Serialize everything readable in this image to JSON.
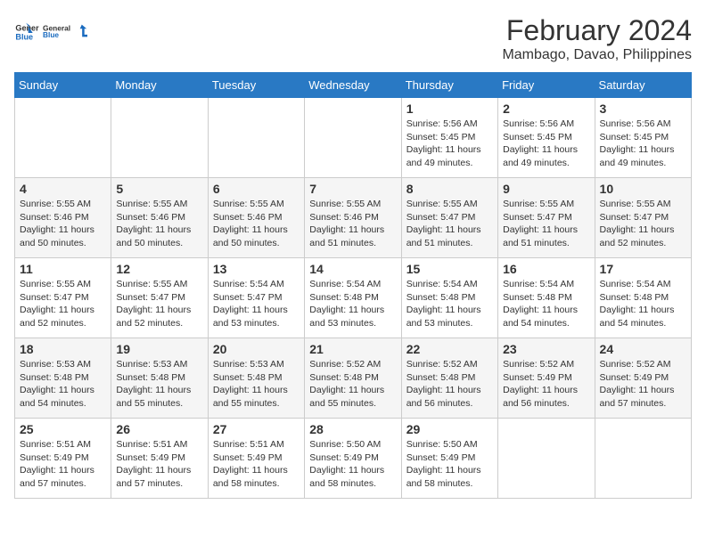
{
  "logo": {
    "line1": "General",
    "line2": "Blue"
  },
  "title": "February 2024",
  "subtitle": "Mambago, Davao, Philippines",
  "days_of_week": [
    "Sunday",
    "Monday",
    "Tuesday",
    "Wednesday",
    "Thursday",
    "Friday",
    "Saturday"
  ],
  "weeks": [
    [
      {
        "day": "",
        "info": ""
      },
      {
        "day": "",
        "info": ""
      },
      {
        "day": "",
        "info": ""
      },
      {
        "day": "",
        "info": ""
      },
      {
        "day": "1",
        "info": "Sunrise: 5:56 AM\nSunset: 5:45 PM\nDaylight: 11 hours\nand 49 minutes."
      },
      {
        "day": "2",
        "info": "Sunrise: 5:56 AM\nSunset: 5:45 PM\nDaylight: 11 hours\nand 49 minutes."
      },
      {
        "day": "3",
        "info": "Sunrise: 5:56 AM\nSunset: 5:45 PM\nDaylight: 11 hours\nand 49 minutes."
      }
    ],
    [
      {
        "day": "4",
        "info": "Sunrise: 5:55 AM\nSunset: 5:46 PM\nDaylight: 11 hours\nand 50 minutes."
      },
      {
        "day": "5",
        "info": "Sunrise: 5:55 AM\nSunset: 5:46 PM\nDaylight: 11 hours\nand 50 minutes."
      },
      {
        "day": "6",
        "info": "Sunrise: 5:55 AM\nSunset: 5:46 PM\nDaylight: 11 hours\nand 50 minutes."
      },
      {
        "day": "7",
        "info": "Sunrise: 5:55 AM\nSunset: 5:46 PM\nDaylight: 11 hours\nand 51 minutes."
      },
      {
        "day": "8",
        "info": "Sunrise: 5:55 AM\nSunset: 5:47 PM\nDaylight: 11 hours\nand 51 minutes."
      },
      {
        "day": "9",
        "info": "Sunrise: 5:55 AM\nSunset: 5:47 PM\nDaylight: 11 hours\nand 51 minutes."
      },
      {
        "day": "10",
        "info": "Sunrise: 5:55 AM\nSunset: 5:47 PM\nDaylight: 11 hours\nand 52 minutes."
      }
    ],
    [
      {
        "day": "11",
        "info": "Sunrise: 5:55 AM\nSunset: 5:47 PM\nDaylight: 11 hours\nand 52 minutes."
      },
      {
        "day": "12",
        "info": "Sunrise: 5:55 AM\nSunset: 5:47 PM\nDaylight: 11 hours\nand 52 minutes."
      },
      {
        "day": "13",
        "info": "Sunrise: 5:54 AM\nSunset: 5:47 PM\nDaylight: 11 hours\nand 53 minutes."
      },
      {
        "day": "14",
        "info": "Sunrise: 5:54 AM\nSunset: 5:48 PM\nDaylight: 11 hours\nand 53 minutes."
      },
      {
        "day": "15",
        "info": "Sunrise: 5:54 AM\nSunset: 5:48 PM\nDaylight: 11 hours\nand 53 minutes."
      },
      {
        "day": "16",
        "info": "Sunrise: 5:54 AM\nSunset: 5:48 PM\nDaylight: 11 hours\nand 54 minutes."
      },
      {
        "day": "17",
        "info": "Sunrise: 5:54 AM\nSunset: 5:48 PM\nDaylight: 11 hours\nand 54 minutes."
      }
    ],
    [
      {
        "day": "18",
        "info": "Sunrise: 5:53 AM\nSunset: 5:48 PM\nDaylight: 11 hours\nand 54 minutes."
      },
      {
        "day": "19",
        "info": "Sunrise: 5:53 AM\nSunset: 5:48 PM\nDaylight: 11 hours\nand 55 minutes."
      },
      {
        "day": "20",
        "info": "Sunrise: 5:53 AM\nSunset: 5:48 PM\nDaylight: 11 hours\nand 55 minutes."
      },
      {
        "day": "21",
        "info": "Sunrise: 5:52 AM\nSunset: 5:48 PM\nDaylight: 11 hours\nand 55 minutes."
      },
      {
        "day": "22",
        "info": "Sunrise: 5:52 AM\nSunset: 5:48 PM\nDaylight: 11 hours\nand 56 minutes."
      },
      {
        "day": "23",
        "info": "Sunrise: 5:52 AM\nSunset: 5:49 PM\nDaylight: 11 hours\nand 56 minutes."
      },
      {
        "day": "24",
        "info": "Sunrise: 5:52 AM\nSunset: 5:49 PM\nDaylight: 11 hours\nand 57 minutes."
      }
    ],
    [
      {
        "day": "25",
        "info": "Sunrise: 5:51 AM\nSunset: 5:49 PM\nDaylight: 11 hours\nand 57 minutes."
      },
      {
        "day": "26",
        "info": "Sunrise: 5:51 AM\nSunset: 5:49 PM\nDaylight: 11 hours\nand 57 minutes."
      },
      {
        "day": "27",
        "info": "Sunrise: 5:51 AM\nSunset: 5:49 PM\nDaylight: 11 hours\nand 58 minutes."
      },
      {
        "day": "28",
        "info": "Sunrise: 5:50 AM\nSunset: 5:49 PM\nDaylight: 11 hours\nand 58 minutes."
      },
      {
        "day": "29",
        "info": "Sunrise: 5:50 AM\nSunset: 5:49 PM\nDaylight: 11 hours\nand 58 minutes."
      },
      {
        "day": "",
        "info": ""
      },
      {
        "day": "",
        "info": ""
      }
    ]
  ]
}
